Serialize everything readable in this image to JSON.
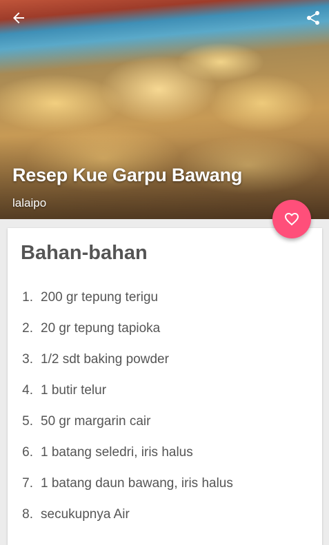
{
  "header": {
    "back_icon": "arrow-left-icon",
    "share_icon": "share-icon"
  },
  "recipe": {
    "title": "Resep Kue Garpu Bawang",
    "author": "lalaipo"
  },
  "fab": {
    "icon": "heart-outline-icon",
    "color": "#ff4f7a"
  },
  "ingredients": {
    "title": "Bahan-bahan",
    "items": [
      {
        "num": "1.",
        "text": "200 gr tepung terigu"
      },
      {
        "num": "2.",
        "text": "20 gr tepung tapioka"
      },
      {
        "num": "3.",
        "text": "1/2 sdt baking powder"
      },
      {
        "num": "4.",
        "text": "1 butir telur"
      },
      {
        "num": "5.",
        "text": "50 gr margarin cair"
      },
      {
        "num": "6.",
        "text": "1 batang seledri, iris halus"
      },
      {
        "num": "7.",
        "text": "1 batang daun bawang, iris halus"
      },
      {
        "num": "8.",
        "text": "secukupnya Air"
      }
    ]
  }
}
